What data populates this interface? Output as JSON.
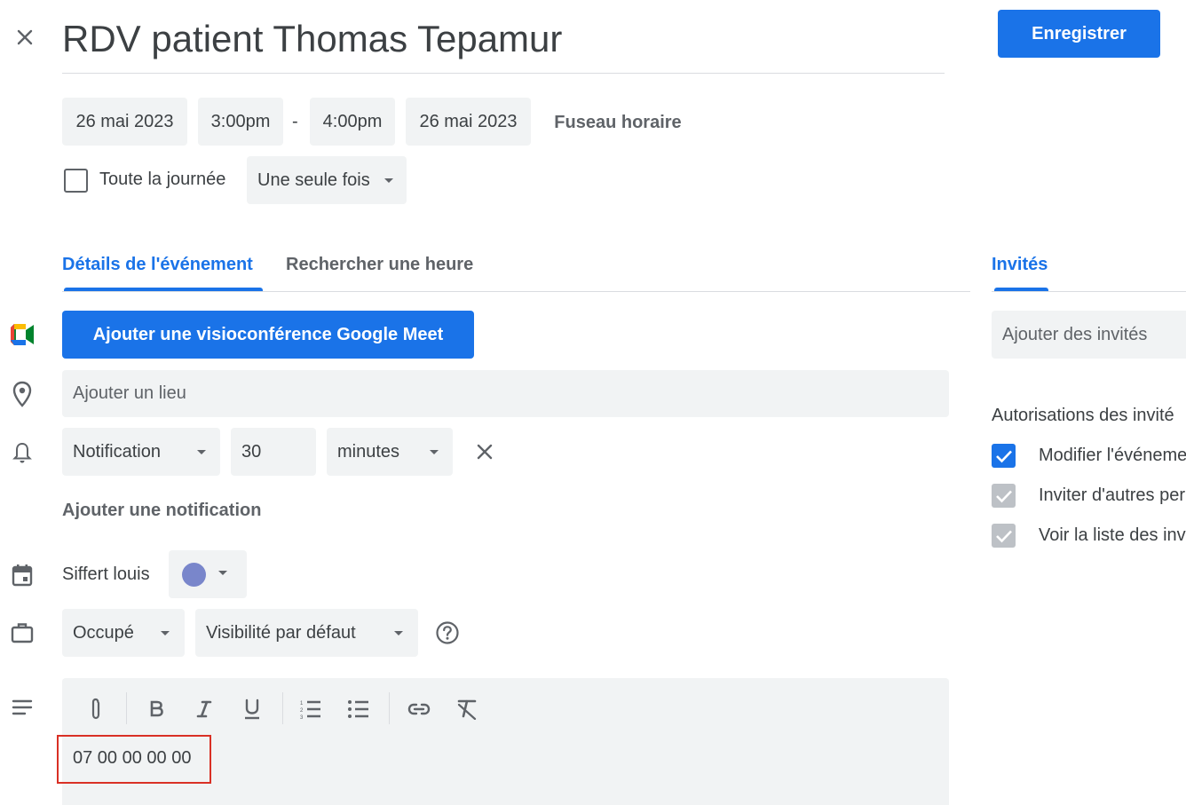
{
  "header": {
    "close_icon": "close-icon",
    "title": "RDV patient Thomas Tepamur",
    "save_label": "Enregistrer"
  },
  "datetime": {
    "start_date": "26 mai 2023",
    "start_time": "3:00pm",
    "separator": "-",
    "end_time": "4:00pm",
    "end_date": "26 mai 2023",
    "timezone_label": "Fuseau horaire",
    "all_day_label": "Toute la journée",
    "all_day_checked": false,
    "recurrence": "Une seule fois"
  },
  "tabs": {
    "details": "Détails de l'événement",
    "find_time": "Rechercher une heure",
    "guests": "Invités"
  },
  "details": {
    "meet_button": "Ajouter une visioconférence Google Meet",
    "location_placeholder": "Ajouter un lieu",
    "notification_type": "Notification",
    "notification_value": "30",
    "notification_unit": "minutes",
    "add_notification": "Ajouter une notification",
    "calendar_name": "Siffert louis",
    "calendar_color": "#7986cb",
    "availability": "Occupé",
    "visibility": "Visibilité par défaut",
    "description_text": "07 00 00 00 00"
  },
  "guests": {
    "add_placeholder": "Ajouter des invités",
    "permissions_title": "Autorisations des invité",
    "permissions": [
      {
        "label": "Modifier l'événeme",
        "checked": true,
        "enabled": true
      },
      {
        "label": "Inviter d'autres per",
        "checked": true,
        "enabled": false
      },
      {
        "label": "Voir la liste des inv",
        "checked": true,
        "enabled": false
      }
    ]
  },
  "colors": {
    "accent": "#1a73e8",
    "chip_bg": "#f1f3f4",
    "highlight_border": "#d93025"
  }
}
